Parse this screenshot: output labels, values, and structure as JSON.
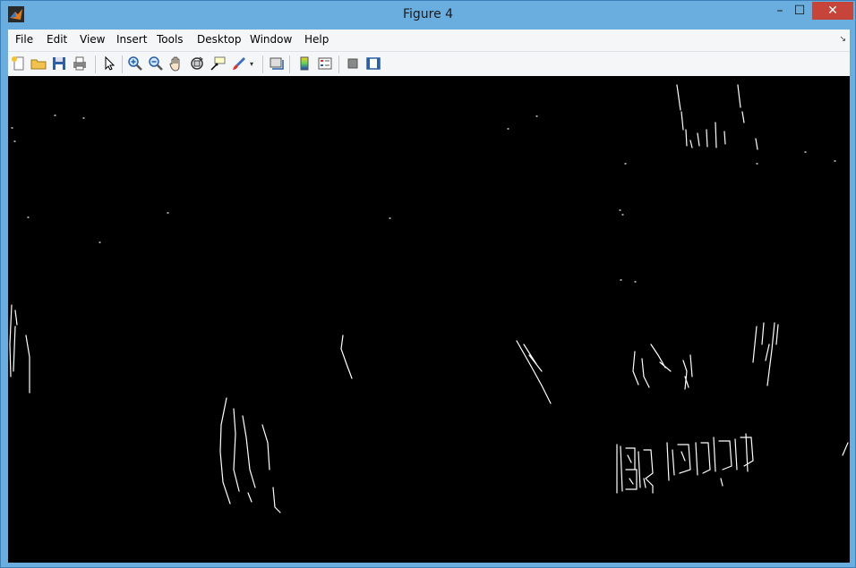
{
  "window": {
    "title": "Figure 4"
  },
  "menu": {
    "items": [
      "File",
      "Edit",
      "View",
      "Insert",
      "Tools",
      "Desktop",
      "Window",
      "Help"
    ]
  },
  "toolbar": {
    "buttons": [
      "new-figure",
      "open-file",
      "save-figure",
      "print-figure",
      "edit-plot",
      "zoom-in",
      "zoom-out",
      "pan",
      "rotate-3d",
      "data-cursor",
      "brush",
      "link-plot",
      "colorbar",
      "legend",
      "hide-plot-tools",
      "show-plot-tools"
    ]
  },
  "figure": {
    "background": "#000000",
    "content": "binary edge-detection image"
  }
}
